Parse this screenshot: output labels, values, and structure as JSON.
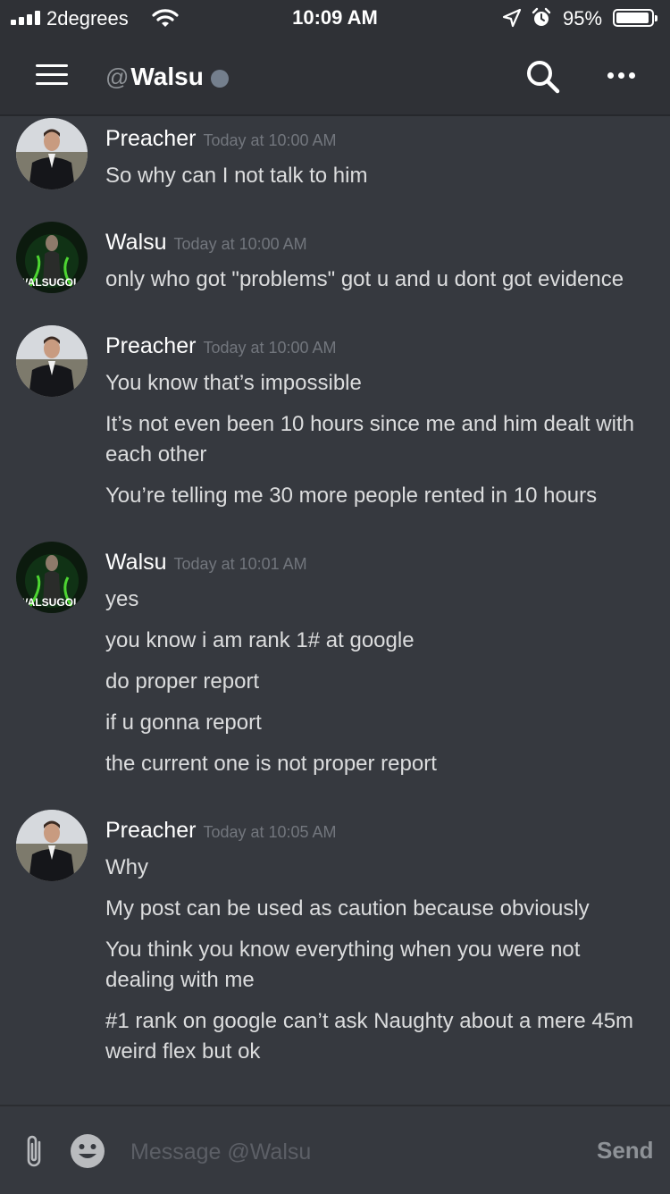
{
  "status_bar": {
    "carrier": "2degrees",
    "time": "10:09 AM",
    "battery_percent": "95%",
    "battery_level": 0.95,
    "icons": [
      "signal-icon",
      "wifi-icon",
      "location-icon",
      "alarm-icon",
      "battery-icon"
    ]
  },
  "header": {
    "at_symbol": "@",
    "username": "Walsu",
    "status_color": "#747f8d",
    "icons": [
      "hamburger-menu-icon",
      "search-icon",
      "more-options-icon"
    ]
  },
  "messages": [
    {
      "author": "Preacher",
      "timestamp": "Today at 10:00 AM",
      "lines": [
        "So why can I not talk to him"
      ]
    },
    {
      "author": "Walsu",
      "timestamp": "Today at 10:00 AM",
      "avatar_text": "WALSUGOI",
      "lines": [
        "only who got \"problems\" got u and u dont got evidence"
      ]
    },
    {
      "author": "Preacher",
      "timestamp": "Today at 10:00 AM",
      "lines": [
        "You know that’s impossible",
        "It’s not even been 10 hours since me and him dealt with",
        "each other",
        "You’re telling me 30 more people rented in 10 hours"
      ]
    },
    {
      "author": "Walsu",
      "timestamp": "Today at 10:01 AM",
      "avatar_text": "WALSUGOI",
      "lines": [
        "yes",
        "you know i am rank 1# at google",
        "do proper report",
        "if u gonna report",
        "the current one is not proper report"
      ]
    },
    {
      "author": "Preacher",
      "timestamp": "Today at 10:05 AM",
      "lines": [
        "Why",
        "My post can be used as caution because obviously",
        "You think you know everything when you were not",
        "dealing with me",
        "#1 rank on google can’t ask Naughty about a mere 45m",
        "weird flex but ok"
      ]
    }
  ],
  "composer": {
    "placeholder": "Message @Walsu",
    "value": "",
    "send_label": "Send",
    "icons": [
      "paperclip-icon",
      "emoji-icon"
    ]
  }
}
